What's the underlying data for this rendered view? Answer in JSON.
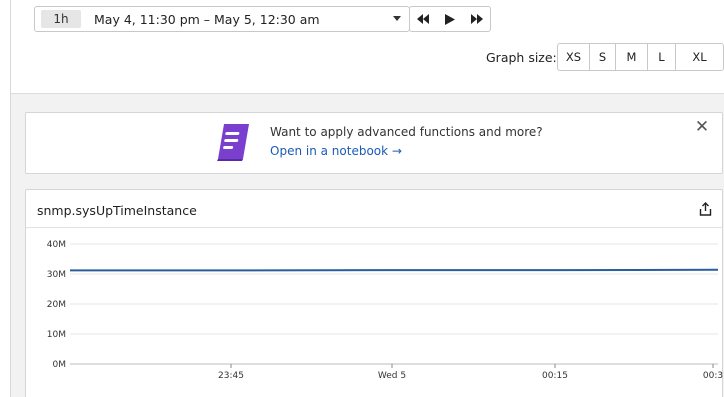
{
  "time_picker": {
    "range_badge": "1h",
    "range_text": "May 4, 11:30 pm – May 5, 12:30 am"
  },
  "stepper": {
    "back_icon": "rewind-icon",
    "play_icon": "play-icon",
    "forward_icon": "fast-forward-icon"
  },
  "graph_size": {
    "label": "Graph size:",
    "options": [
      "XS",
      "S",
      "M",
      "L",
      "XL"
    ]
  },
  "banner": {
    "title": "Want to apply advanced functions and more?",
    "link": "Open in a notebook →",
    "icon": "notebook-icon",
    "accent": "#7b3fcf"
  },
  "widget": {
    "title": "snmp.sysUpTimeInstance",
    "share_icon": "share-icon"
  },
  "chart_data": {
    "type": "line",
    "y_ticks": [
      "40M",
      "30M",
      "20M",
      "10M",
      "0M"
    ],
    "x_ticks": [
      "23:45",
      "Wed 5",
      "00:15",
      "00:3"
    ],
    "ylim": [
      0,
      40000000
    ],
    "series": [
      {
        "color": "#2a5d9e",
        "x": [
          "23:30",
          "23:45",
          "00:00",
          "00:15",
          "00:30"
        ],
        "values": [
          31200000,
          31200000,
          31300000,
          31300000,
          31400000
        ]
      }
    ],
    "grid": true
  }
}
